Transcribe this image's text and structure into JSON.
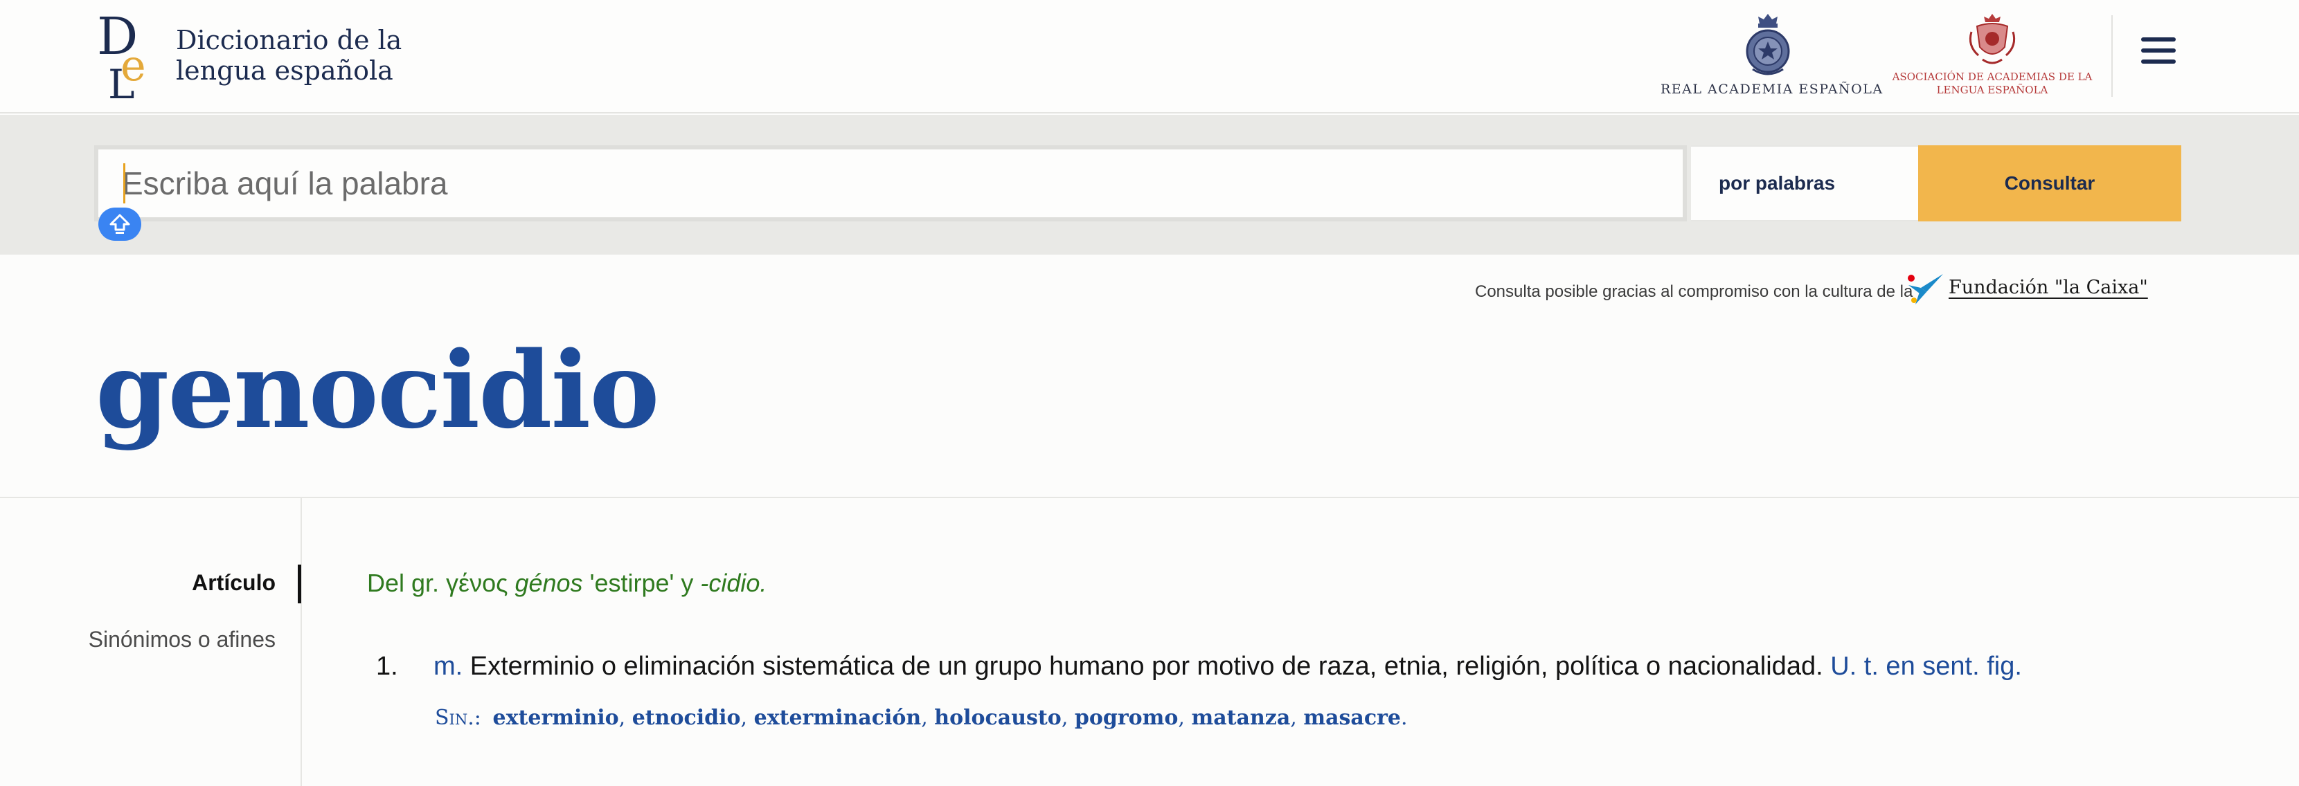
{
  "header": {
    "title_line1": "Diccionario de la",
    "title_line2": "lengua española",
    "rae_label": "REAL ACADEMIA ESPAÑOLA",
    "asale_line1": "ASOCIACIÓN DE ACADEMIAS DE LA",
    "asale_line2": "LENGUA ESPAÑOLA"
  },
  "search": {
    "placeholder": "Escriba aquí la palabra",
    "value": "",
    "mode": "por palabras",
    "submit_label": "Consultar"
  },
  "sponsor": {
    "text": "Consulta posible gracias al compromiso con la cultura de la",
    "link": "Fundación \"la Caixa\""
  },
  "entry": {
    "headword": "genocidio",
    "etymology": {
      "prefix": "Del gr. γένος ",
      "translit": "génos",
      "gloss": " 'estirpe' y ",
      "suffix": "-cidio."
    },
    "definitions": [
      {
        "number": "1.",
        "category": "m.",
        "text": " Exterminio o eliminación sistemática de un grupo humano por motivo de raza, etnia, religión, política o nacionalidad. ",
        "usage": "U. t. en sent. fig.",
        "synonyms_label": "Sin.:",
        "synonyms": [
          "exterminio",
          "etnocidio",
          "exterminación",
          "holocausto",
          "pogromo",
          "matanza",
          "masacre"
        ]
      }
    ]
  },
  "sidebar": {
    "items": [
      {
        "label": "Artículo",
        "active": true
      },
      {
        "label": "Sinónimos o afines",
        "active": false
      }
    ]
  },
  "colors": {
    "brand_navy": "#1c2b4f",
    "headword_blue": "#1e4c9a",
    "accent_gold": "#f2b64c",
    "etymology_green": "#2f7a1f",
    "keyboard_blue": "#3a84f2"
  },
  "icons": {
    "logo": "dle-logo-icon",
    "rae_crest": "rae-crest-icon",
    "asale_crest": "asale-crest-icon",
    "menu": "hamburger-menu-icon",
    "keyboard": "keyboard-toggle-icon",
    "sponsor": "la-caixa-star-icon"
  }
}
